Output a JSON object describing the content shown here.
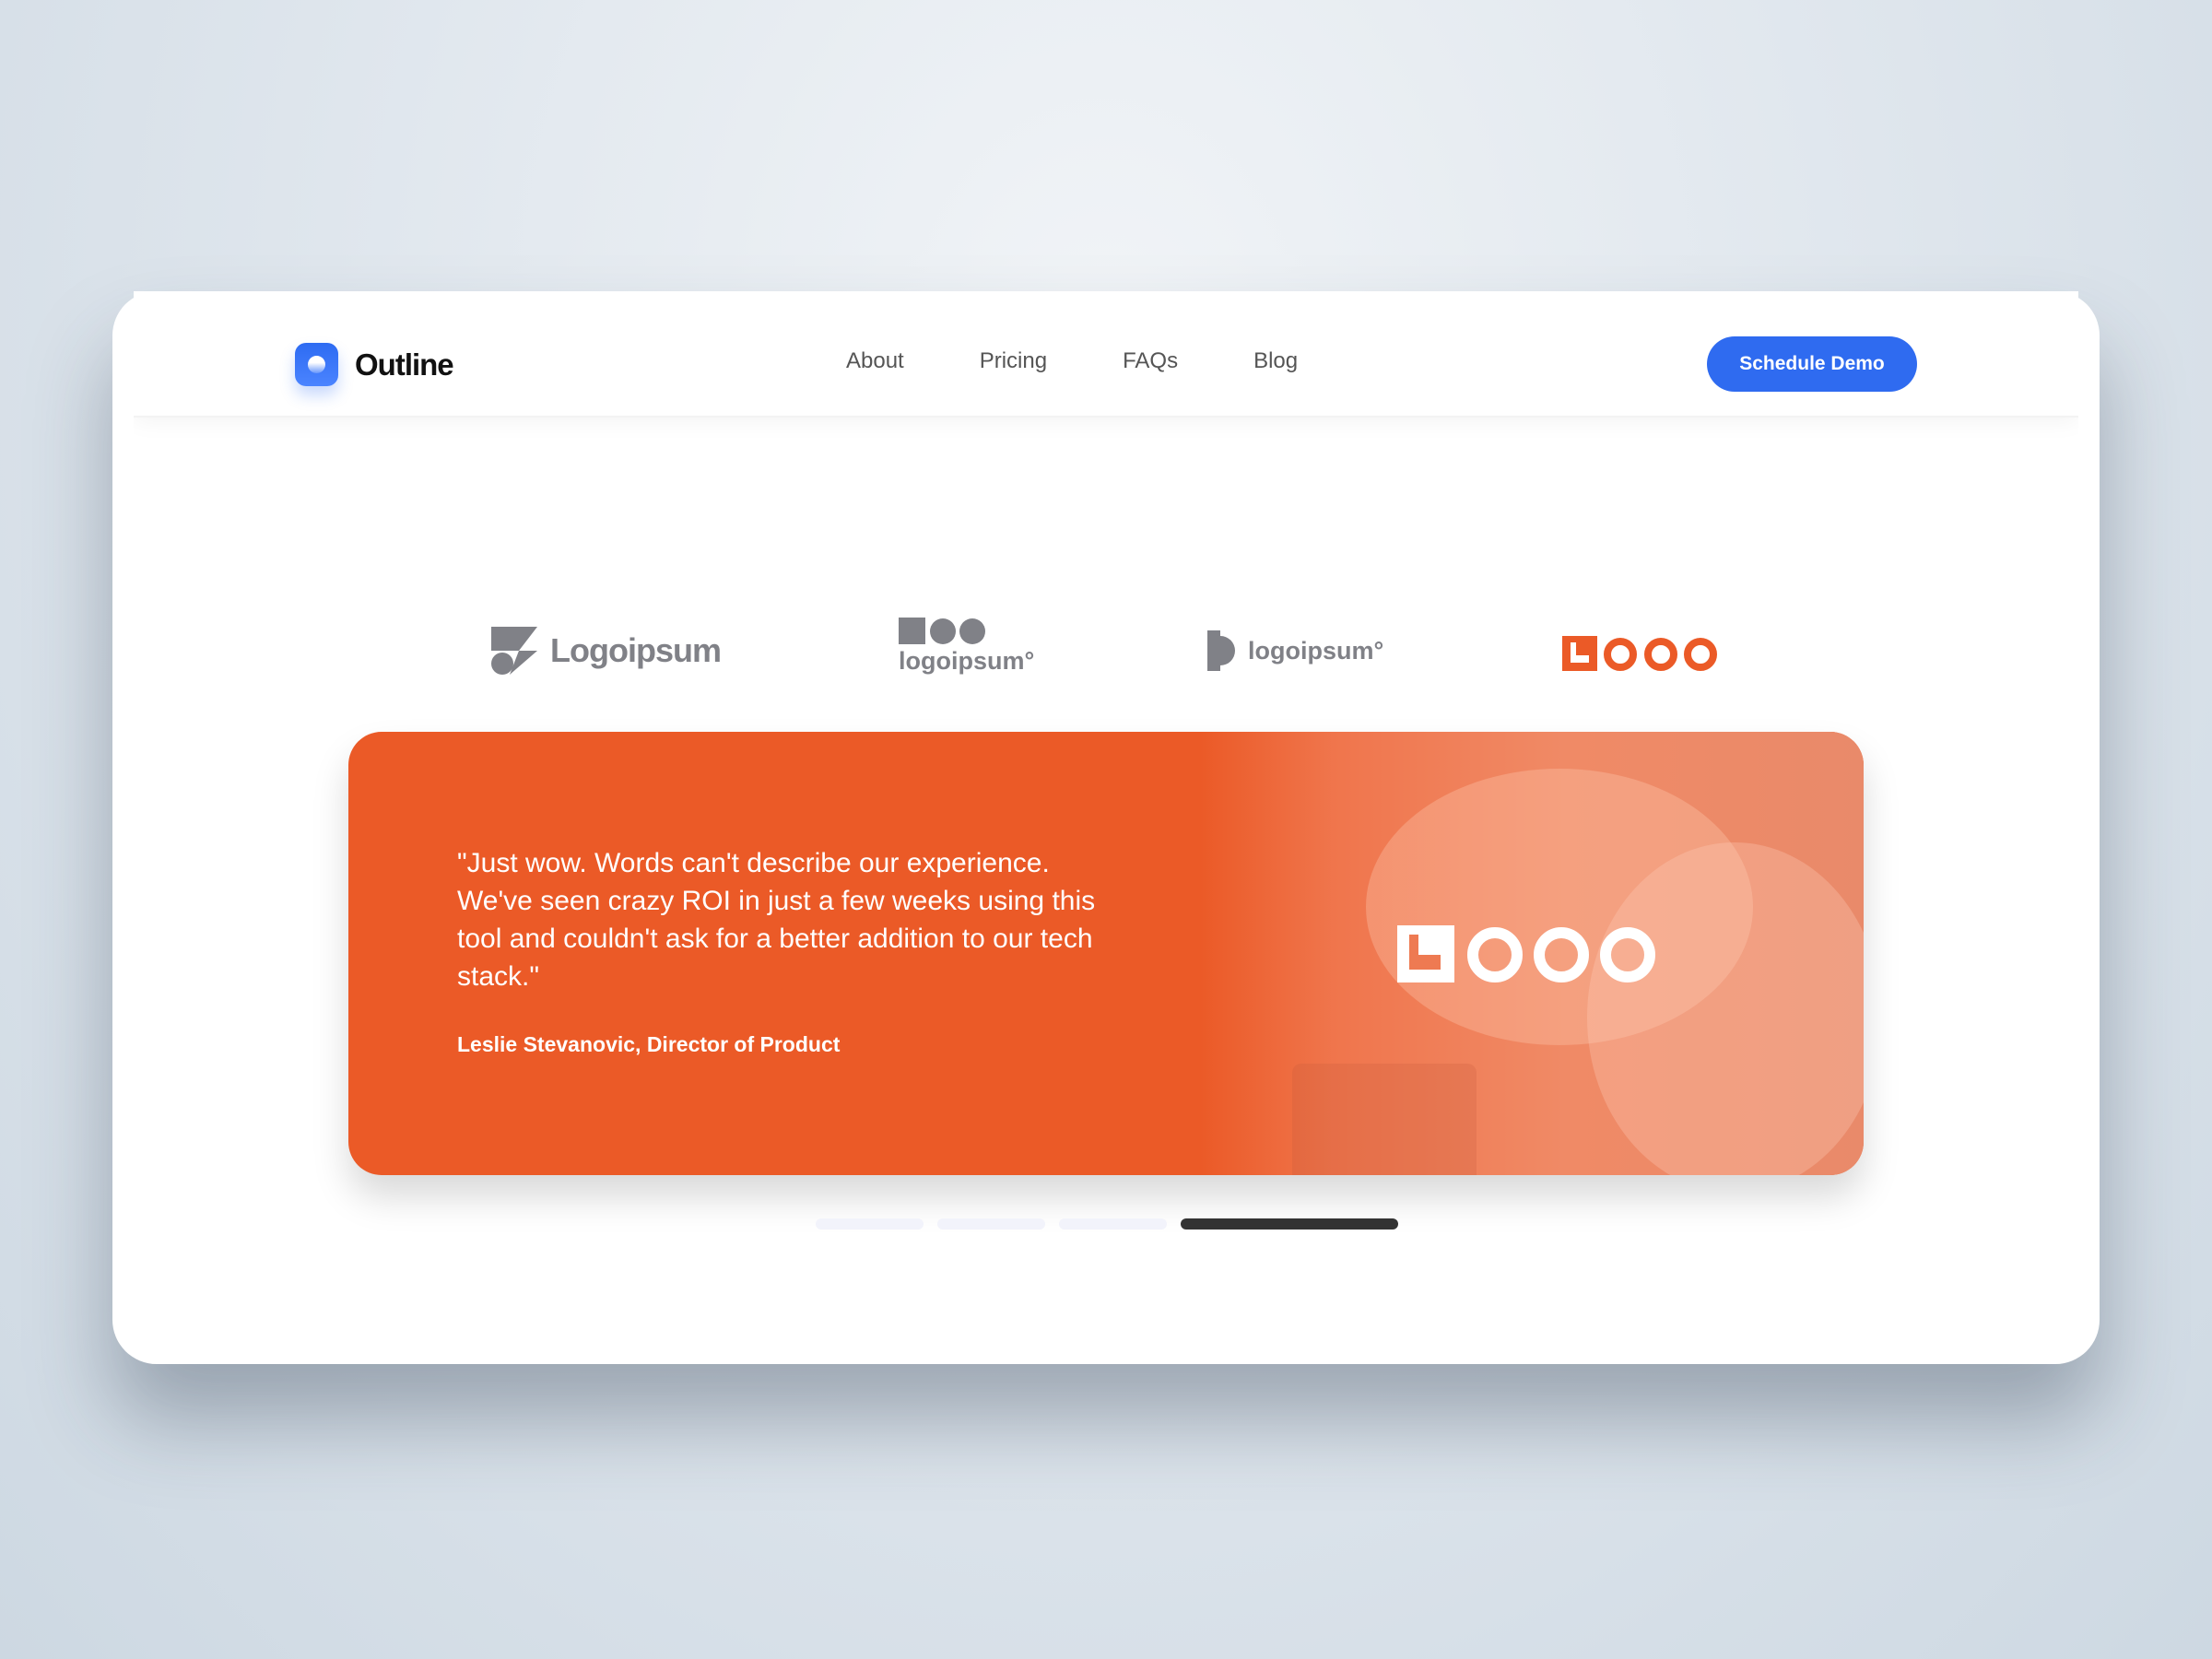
{
  "nav": {
    "brand": "Outline",
    "links": [
      "About",
      "Pricing",
      "FAQs",
      "Blog"
    ],
    "cta": "Schedule Demo"
  },
  "logos": [
    {
      "text": "Logoipsum"
    },
    {
      "text": "logoipsum°"
    },
    {
      "text": "logoipsum°"
    },
    {
      "text": "LOGO"
    }
  ],
  "testimonial": {
    "quote": "\"Just wow. Words can't describe our experience. We've seen crazy ROI in just a few weeks using this tool and couldn't ask for a better addition to our tech stack.\"",
    "author": "Leslie Stevanovic, Director of Product",
    "company_logo": "LOGO"
  },
  "carousel": {
    "total": 4,
    "active": 4
  },
  "colors": {
    "accent": "#2f6bf0",
    "card": "#eb5a27"
  }
}
